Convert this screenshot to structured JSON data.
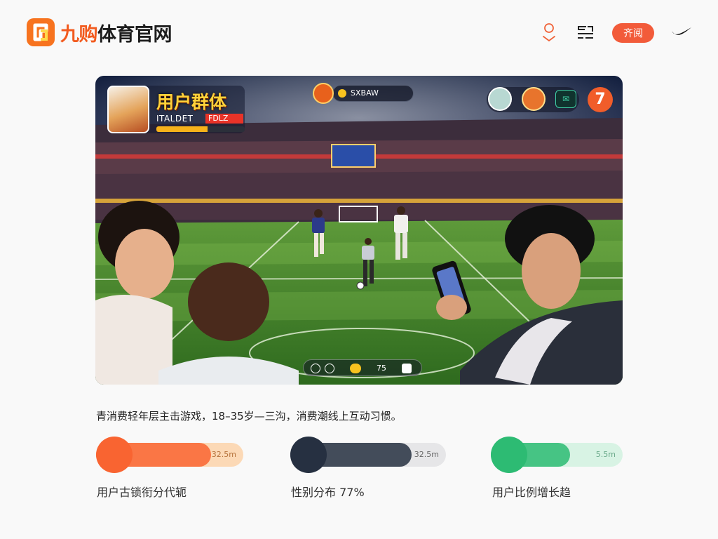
{
  "brand": {
    "name_accent": "九购",
    "name_rest": "体育官网",
    "colors": {
      "accent": "#f25b1f",
      "text": "#1d1d1d"
    }
  },
  "header": {
    "icons": [
      "location-pin-icon",
      "menu-lines-icon",
      "nike-swoosh-icon"
    ],
    "action_button": "齐阅"
  },
  "hero": {
    "alt_text": "体育场内球迷观看足球比赛的游戏界面",
    "hud_card": {
      "title": "用户群体",
      "subtitle": "ITALDET",
      "tag": "FDLZ",
      "bar_fill": 0.58
    },
    "hud_top": {
      "text": "SXBAW"
    },
    "hud_right": {
      "chat_icon": "chat-icon",
      "score": "7"
    },
    "hud_bottom": {
      "text": "75"
    }
  },
  "description": "青消费轻年层主击游戏，18–35岁—三沟，消费潮线上互动习惯。",
  "stats": [
    {
      "value": "32.5m",
      "label": "用户古锁衔分代轭",
      "color": "#f96431",
      "track": "#fcd9b6",
      "fill": 0.78,
      "label_key": "age"
    },
    {
      "value": "32.5m",
      "label": "性别分布 77%",
      "color": "#263041",
      "track": "#e6e6e8",
      "fill": 0.78,
      "label_key": "gender"
    },
    {
      "value": "5.5m",
      "label": "用户比例增长趋",
      "color": "#2dbb73",
      "track": "#d8f3e4",
      "fill": 0.6,
      "label_key": "growth"
    }
  ]
}
